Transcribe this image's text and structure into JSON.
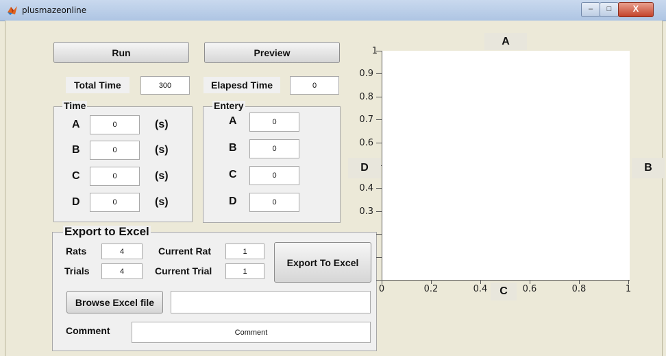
{
  "window": {
    "title": "plusmazeonline",
    "minimize_glyph": "–",
    "maximize_glyph": "□",
    "close_glyph": "X"
  },
  "buttons": {
    "run": "Run",
    "preview": "Preview",
    "export": "Export To  Excel",
    "browse": "Browse Excel file"
  },
  "timing": {
    "total_time_label": "Total Time",
    "total_time_value": "300",
    "elapsed_label": "Elapesd Time",
    "elapsed_value": "0"
  },
  "time_group": {
    "title": "Time",
    "unit": "(s)",
    "rows": [
      {
        "label": "A",
        "value": "0"
      },
      {
        "label": "B",
        "value": "0"
      },
      {
        "label": "C",
        "value": "0"
      },
      {
        "label": "D",
        "value": "0"
      }
    ]
  },
  "entry_group": {
    "title": "Entery",
    "rows": [
      {
        "label": "A",
        "value": "0"
      },
      {
        "label": "B",
        "value": "0"
      },
      {
        "label": "C",
        "value": "0"
      },
      {
        "label": "D",
        "value": "0"
      }
    ]
  },
  "export_group": {
    "title": "Export to Excel",
    "rats_label": "Rats",
    "rats_value": "4",
    "trials_label": "Trials",
    "trials_value": "4",
    "current_rat_label": "Current Rat",
    "current_rat_value": "1",
    "current_trial_label": "Current Trial",
    "current_trial_value": "1",
    "file_path": "",
    "comment_label": "Comment",
    "comment_value": "Comment"
  },
  "plot": {
    "y_ticks": [
      "1",
      "0.9",
      "0.8",
      "0.7",
      "0.6",
      "",
      "0.4",
      "0.3",
      "",
      "",
      ""
    ],
    "x_ticks": [
      "0",
      "0.2",
      "0.4",
      "0.6",
      "0.8",
      "1"
    ],
    "direction_labels": {
      "top": "A",
      "right": "B",
      "bottom": "C",
      "left": "D"
    }
  },
  "colors": {
    "background": "#ece9d8",
    "panel": "#f0f0f0"
  }
}
